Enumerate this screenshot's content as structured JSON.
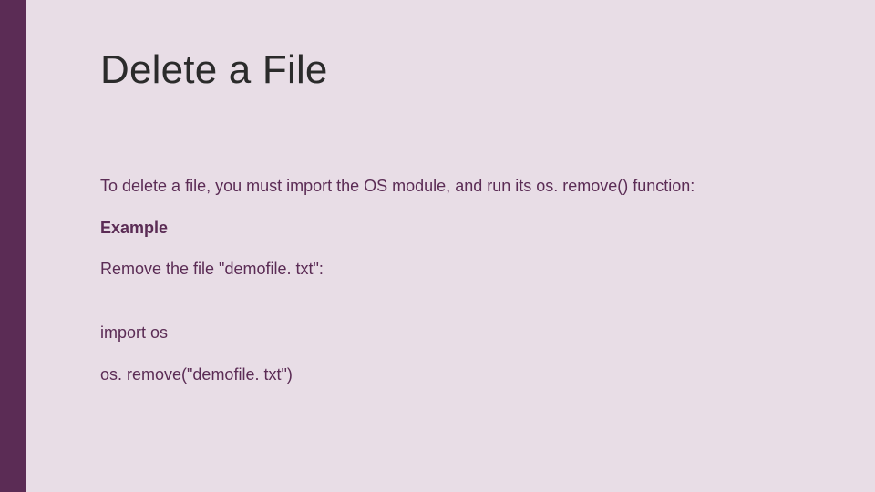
{
  "slide": {
    "title": "Delete a File",
    "intro": "To delete a file, you must import the OS module, and run its os. remove() function:",
    "example_label": "Example",
    "example_desc": "Remove the file \"demofile. txt\":",
    "code_line1": "import os",
    "code_line2": "os. remove(\"demofile. txt\")"
  }
}
